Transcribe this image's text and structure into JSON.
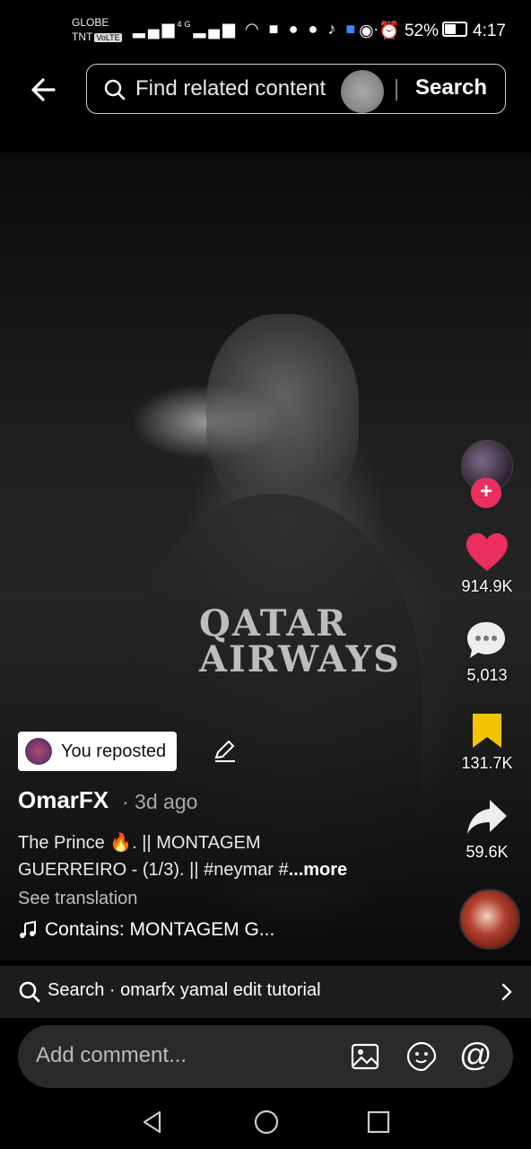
{
  "status_bar": {
    "carrier_1": "GLOBE",
    "carrier_2": "TNT",
    "volte": "VoLTE",
    "network": "4G",
    "battery": "52%",
    "time": "4:17"
  },
  "top_bar": {
    "search_placeholder": "Find related content",
    "search_button": "Search"
  },
  "video": {
    "overlay_text": "QATAR\nAIRWAYS"
  },
  "actions": {
    "likes": "914.9K",
    "comments": "5,013",
    "saves": "131.7K",
    "shares": "59.6K"
  },
  "repost": {
    "label": "You reposted"
  },
  "post": {
    "username": "OmarFX",
    "time_ago": "· 3d ago",
    "caption_line_1": "The Prince 🔥. || MONTAGEM",
    "caption_line_2": "GUERREIRO - (1/3). || #neymar #",
    "caption_more": "...more",
    "see_translation": "See translation",
    "music": "Contains: MONTAGEM G..."
  },
  "search_suggestion": {
    "text": "Search · omarfx yamal edit tutorial"
  },
  "comment": {
    "placeholder": "Add comment..."
  },
  "colors": {
    "accent": "#ea2e5e",
    "like": "#ea2e5e",
    "bookmark": "#f5c400"
  }
}
